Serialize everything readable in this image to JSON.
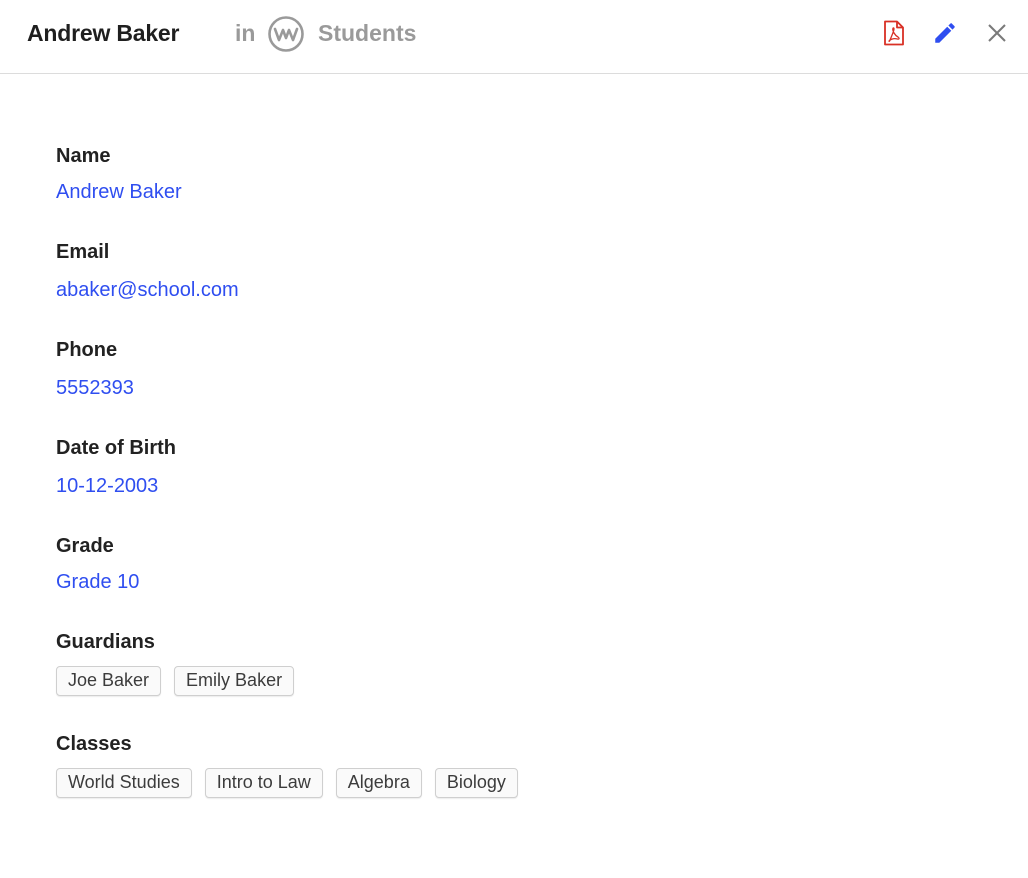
{
  "header": {
    "title": "Andrew Baker",
    "in_label": "in",
    "app_name": "Students",
    "app_logo_icon": "wave-circle-icon",
    "actions": [
      {
        "name": "pdf-export",
        "icon": "pdf-file-icon",
        "color": "#d93025"
      },
      {
        "name": "edit",
        "icon": "pencil-icon",
        "color": "#2f4ef0"
      },
      {
        "name": "close",
        "icon": "close-icon",
        "color": "#7a7a7a"
      }
    ]
  },
  "fields": {
    "name": {
      "label": "Name",
      "value": "Andrew Baker"
    },
    "email": {
      "label": "Email",
      "value": "abaker@school.com"
    },
    "phone": {
      "label": "Phone",
      "value": "5552393"
    },
    "dob": {
      "label": "Date of Birth",
      "value": "10-12-2003"
    },
    "grade": {
      "label": "Grade",
      "value": "Grade 10"
    },
    "guardians": {
      "label": "Guardians",
      "items": [
        "Joe Baker",
        "Emily Baker"
      ]
    },
    "classes": {
      "label": "Classes",
      "items": [
        "World Studies",
        "Intro to Law",
        "Algebra",
        "Biology"
      ]
    }
  },
  "colors": {
    "link": "#2f4ef0",
    "muted": "#9a9a9a",
    "divider": "#dcdcdc"
  }
}
